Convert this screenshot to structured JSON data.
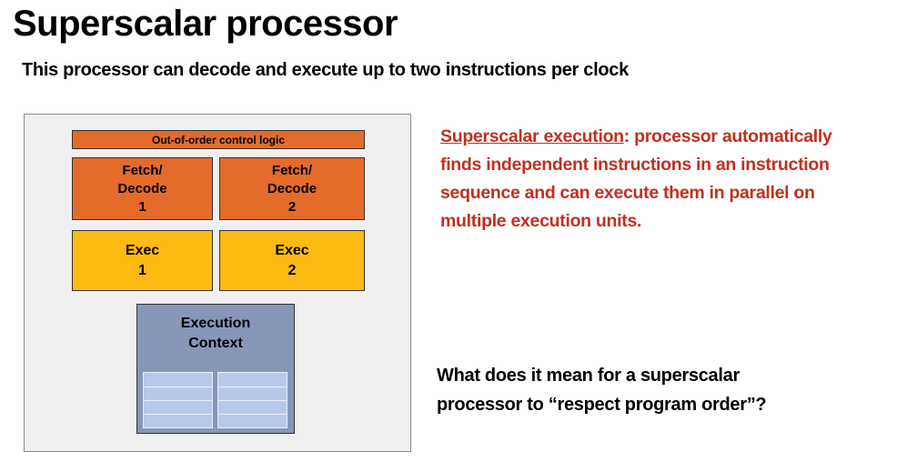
{
  "title": "Superscalar processor",
  "subtitle": "This processor can decode and execute up to two instructions per clock",
  "diagram": {
    "control_logic": "Out-of-order control logic",
    "fetch_decode": [
      {
        "line1": "Fetch/",
        "line2": "Decode",
        "line3": "1"
      },
      {
        "line1": "Fetch/",
        "line2": "Decode",
        "line3": "2"
      }
    ],
    "exec": [
      {
        "line1": "Exec",
        "line2": "1"
      },
      {
        "line1": "Exec",
        "line2": "2"
      }
    ],
    "context": {
      "line1": "Execution",
      "line2": "Context"
    }
  },
  "description": {
    "term": "Superscalar execution",
    "lines": [
      ": processor automatically",
      "finds independent instructions in an instruction",
      "sequence and can execute them in parallel on",
      "multiple execution units."
    ]
  },
  "question": {
    "line1": "What does it mean for a superscalar",
    "line2": "processor to “respect program order”?"
  },
  "colors": {
    "control_orange": "#e46b2a",
    "exec_yellow": "#fdba12",
    "context_blue": "#8896b8",
    "register_blue": "#b8c8ec",
    "accent_red": "#c0301e"
  }
}
